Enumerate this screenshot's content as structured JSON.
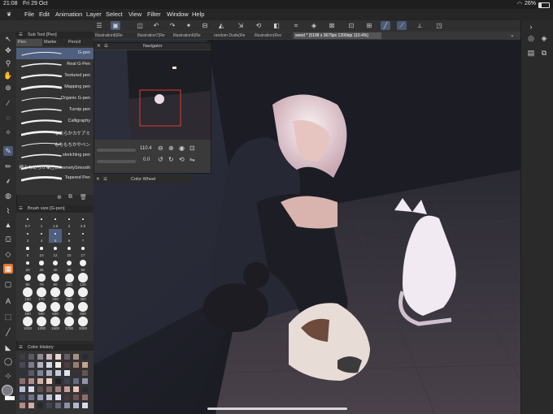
{
  "status_bar": {
    "time": "21:08",
    "date": "Fri 29 Oct",
    "battery": "26%"
  },
  "menu": [
    "File",
    "Edit",
    "Animation",
    "Layer",
    "Select",
    "View",
    "Filter",
    "Window",
    "Help"
  ],
  "tabs": [
    {
      "label": "Illustration8(Re"
    },
    {
      "label": "Illustration7(Re"
    },
    {
      "label": "Illustration6(Re"
    },
    {
      "label": "random Dudu(Re"
    },
    {
      "label": "Illustration(Rec"
    },
    {
      "label": "weed * (5198 x 3679px 1200dpi 110.4%)"
    }
  ],
  "sub_tool": {
    "title": "Sub Tool [Pen]",
    "tabs": [
      "Pen",
      "Marke",
      "Pencil"
    ],
    "brushes": [
      {
        "name": "G-pen",
        "selected": true
      },
      {
        "name": "Real G-Pen"
      },
      {
        "name": "Textured pen"
      },
      {
        "name": "Mapping pen"
      },
      {
        "name": "Organic G-pen"
      },
      {
        "name": "Turnip pen"
      },
      {
        "name": "Calligraphy"
      },
      {
        "name": "なめらかカケアミ"
      },
      {
        "name": "もちもちかやペン"
      },
      {
        "name": "sketching pen"
      },
      {
        "name": "極みなめらか筆圧ExtremelySmooth"
      },
      {
        "name": "Tapered Pen"
      }
    ]
  },
  "brush_size": {
    "title": "Brush size [G-pen]",
    "sizes": [
      [
        "0.7",
        "1",
        "1.5",
        "2",
        "2.5"
      ],
      [
        "3",
        "4",
        "5",
        "6",
        "7"
      ],
      [
        "8",
        "10",
        "12",
        "15",
        "17"
      ],
      [
        "20",
        "25",
        "30",
        "40",
        "50"
      ],
      [
        "60",
        "70",
        "80",
        "100",
        "120"
      ],
      [
        "150",
        "170",
        "200",
        "250",
        "300"
      ],
      [
        "400",
        "500",
        "600",
        "700",
        "800"
      ],
      [
        "1000",
        "1200",
        "1500",
        "1700",
        "2000"
      ]
    ],
    "selected": "5"
  },
  "color_history": {
    "title": "Color History",
    "swatches": [
      "#3d3d46",
      "#5a5963",
      "#8f8a96",
      "#c9b8c0",
      "#e8d6cf",
      "#6c5b6a",
      "#a69284",
      "#2c2a33",
      "#49475a",
      "#7d7a8d",
      "#b4b0c2",
      "#d8d5e6",
      "#f3eee8",
      "#4e3f44",
      "#9a7c6d",
      "#c2a390",
      "#2f3140",
      "#56586b",
      "#7f8399",
      "#a8adc4",
      "#c7cbe0",
      "#e1e4f2",
      "#3b2f36",
      "#6a5158",
      "#8c6b70",
      "#b08b8b",
      "#d4b0aa",
      "#efd3c8",
      "#1f2029",
      "#3e4050",
      "#666a80",
      "#9095ad",
      "#b9bdd6",
      "#dadbee",
      "#5d4a4f",
      "#7e6366",
      "#a47f7f",
      "#c89f98",
      "#e6c4ba",
      "#2a2b35",
      "#474a5c",
      "#6f7389",
      "#979bb3",
      "#bfc3da",
      "#e2e4f1",
      "#47363b",
      "#6b5155",
      "#8f6d6e",
      "#b28b88",
      "#d3aca4",
      "#26272f",
      "#404253",
      "#62667c",
      "#8b8fa6",
      "#b3b7ce",
      "#d8dbea"
    ]
  },
  "navigator": {
    "title": "Navigator",
    "zoom": "110.4",
    "rotation": "0.0"
  },
  "color_wheel": {
    "title": "Color Wheel"
  }
}
